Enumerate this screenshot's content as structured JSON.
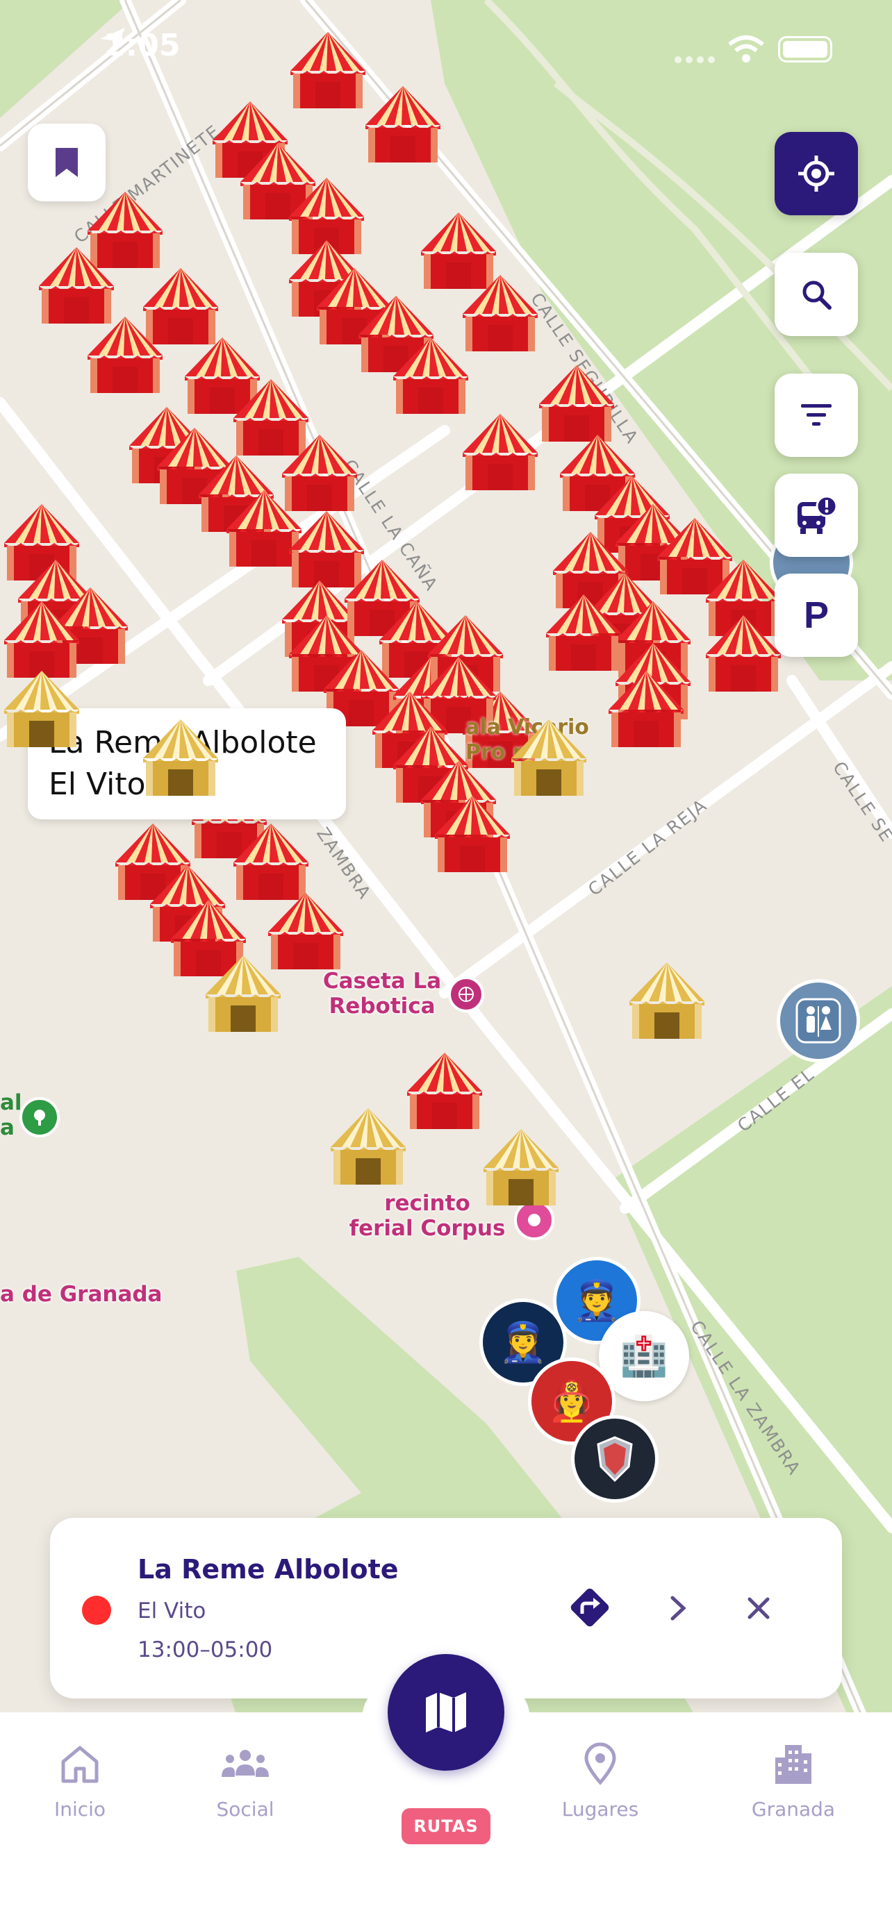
{
  "status_bar": {
    "time": "2:05"
  },
  "map": {
    "streets": [
      "CALLE MARTINETE",
      "CALLE SEGURILLA",
      "CALLE LA CAÑA",
      "CALLE LA REJA",
      "CALLE LA ZAMBRA",
      "CALLE EL",
      "CALLE SE",
      "ZAMBRA"
    ],
    "pois": [
      {
        "name": "Caseta La Rebotica",
        "lines": [
          "Caseta La",
          "Rebotica"
        ],
        "icon": "ferris-wheel-icon"
      },
      {
        "name": "recinto ferial Corpus",
        "lines": [
          "recinto",
          "ferial Corpus"
        ],
        "icon": "pink-dot-icon"
      },
      {
        "name": "a de Granada",
        "lines": [
          "a de Granada"
        ]
      },
      {
        "name": "Sala Vicario Procesión",
        "lines": [
          "ala Vicario",
          "Pro   n"
        ]
      }
    ],
    "green_fragment": [
      "al",
      "a"
    ],
    "tooltip": {
      "line1": "La Reme Albolote",
      "line2": "El Vito"
    },
    "services": [
      "police-icon",
      "police-icon",
      "hospital-icon",
      "firefighter-icon",
      "security-shield-icon",
      "restroom-icon"
    ]
  },
  "side_buttons": [
    "locate-icon",
    "search-icon",
    "filter-icon",
    "bus-alert-icon",
    "parking-icon"
  ],
  "parking_label": "P",
  "card": {
    "title": "La Reme Albolote",
    "subtitle": "El Vito",
    "hours": "13:00–05:00",
    "status_color": "#ff2d2d"
  },
  "tabs": [
    {
      "label": "Inicio",
      "icon": "home-icon"
    },
    {
      "label": "Social",
      "icon": "group-icon"
    },
    {
      "label": "RUTAS",
      "icon": "map-icon"
    },
    {
      "label": "Lugares",
      "icon": "location-pin-icon"
    },
    {
      "label": "Granada",
      "icon": "city-icon"
    }
  ],
  "colors": {
    "accent": "#2b1a7a",
    "tab_inactive": "#a89fc8",
    "rutas_badge": "#f0607e"
  }
}
